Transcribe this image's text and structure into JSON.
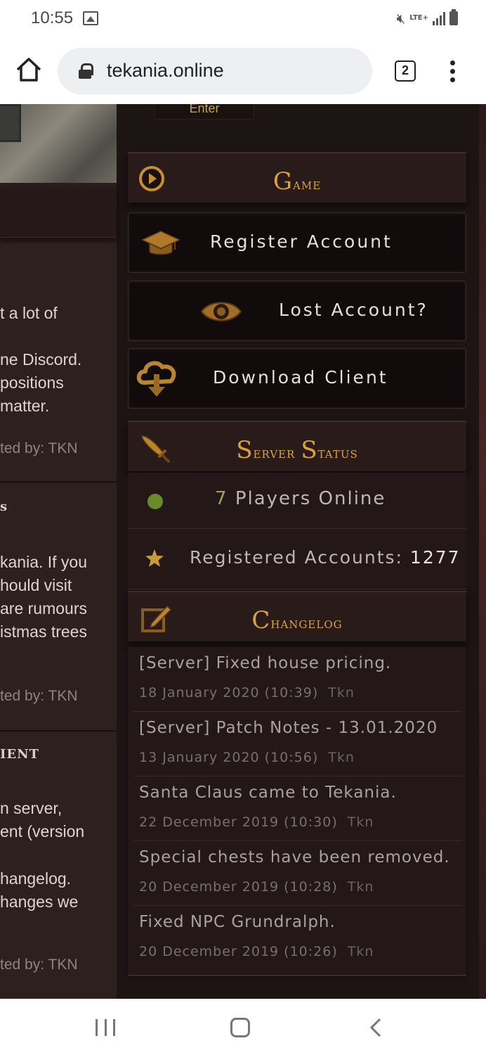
{
  "status_bar": {
    "time": "10:55",
    "network_label": "LTE+"
  },
  "browser": {
    "url": "tekania.online",
    "tab_count": "2"
  },
  "left_column": {
    "post1_lines": [
      "t a lot of",
      "ne Discord.",
      "positions",
      "matter."
    ],
    "post1_by": "ted by: TKN",
    "post2_title_fragment": "s",
    "post2_lines": [
      "kania. If you",
      "hould visit",
      "are rumours",
      "istmas trees"
    ],
    "post2_by": "ted by: TKN",
    "post3_title_fragment": "IENT",
    "post3_lines": [
      "n server,",
      "ent (version",
      "hangelog.",
      "hanges we"
    ],
    "post3_by": "ted by: TKN"
  },
  "login": {
    "enter_label": "Enter"
  },
  "game_section": {
    "title_cap": "G",
    "title_rest": "ame",
    "buttons": [
      {
        "label": "Register Account",
        "icon": "graduation-cap-icon"
      },
      {
        "label": "Lost Account?",
        "icon": "eye-icon"
      },
      {
        "label": "Download Client",
        "icon": "download-cloud-icon"
      }
    ]
  },
  "server_status": {
    "title_cap1": "S",
    "title_rest1": "erver ",
    "title_cap2": "S",
    "title_rest2": "tatus",
    "players_count": "7",
    "players_label": "Players Online",
    "accounts_label": "Registered Accounts:",
    "accounts_value": "1277",
    "online_color": "#6a8a2a",
    "star_color": "#c99a3a"
  },
  "changelog": {
    "title_cap": "C",
    "title_rest": "hangelog",
    "entries": [
      {
        "title": "[Server] Fixed house pricing.",
        "date": "18 January 2020 (10:39)",
        "author": "Tkn"
      },
      {
        "title": "[Server] Patch Notes - 13.01.2020",
        "date": "13 January 2020 (10:56)",
        "author": "Tkn"
      },
      {
        "title": "Santa Claus came to Tekania.",
        "date": "22 December 2019 (10:30)",
        "author": "Tkn"
      },
      {
        "title": "Special chests have been removed.",
        "date": "20 December 2019 (10:28)",
        "author": "Tkn"
      },
      {
        "title": "Fixed NPC Grundralph.",
        "date": "20 December 2019 (10:26)",
        "author": "Tkn"
      }
    ]
  },
  "colors": {
    "gold_accent": "#d7a43c",
    "page_bg": "#1d1414"
  }
}
